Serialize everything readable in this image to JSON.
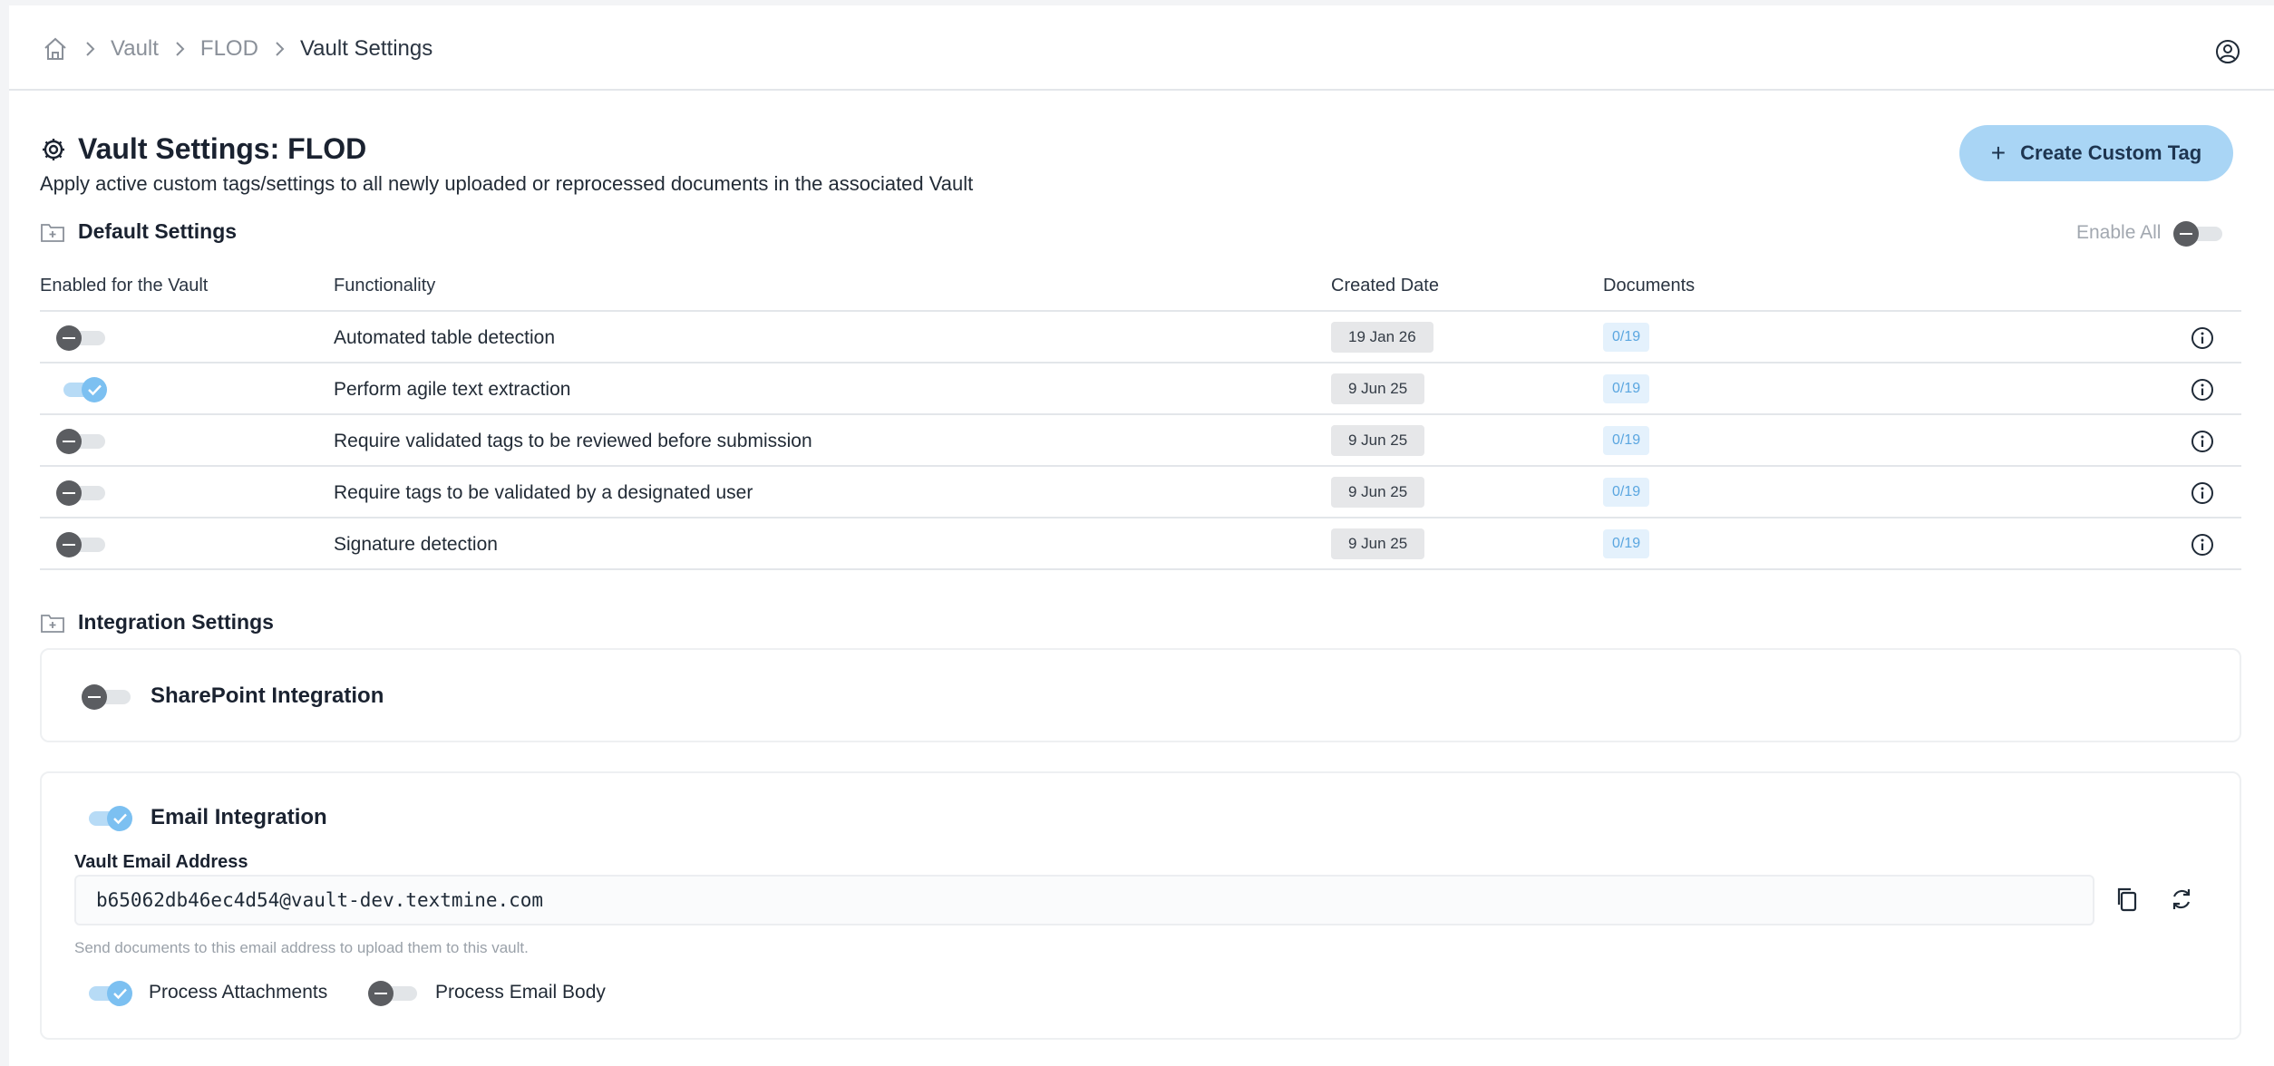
{
  "breadcrumb": {
    "icon": "home-icon",
    "items": [
      "Vault",
      "FLOD",
      "Vault Settings"
    ]
  },
  "user_icon": "user-circle-icon",
  "header": {
    "title": "Vault Settings: FLOD",
    "subtitle": "Apply active custom tags/settings to all newly uploaded or reprocessed documents in the associated Vault",
    "create_button": "Create Custom Tag"
  },
  "default_settings": {
    "title": "Default Settings",
    "enable_all_label": "Enable All",
    "enable_all_on": false,
    "columns": [
      "Enabled for the Vault",
      "Functionality",
      "Created Date",
      "Documents"
    ],
    "rows": [
      {
        "enabled": false,
        "functionality": "Automated table detection",
        "created": "19 Jan 26",
        "documents": "0/19"
      },
      {
        "enabled": true,
        "functionality": "Perform agile text extraction",
        "created": "9 Jun 25",
        "documents": "0/19"
      },
      {
        "enabled": false,
        "functionality": "Require validated tags to be reviewed before submission",
        "created": "9 Jun 25",
        "documents": "0/19"
      },
      {
        "enabled": false,
        "functionality": "Require tags to be validated by a designated user",
        "created": "9 Jun 25",
        "documents": "0/19"
      },
      {
        "enabled": false,
        "functionality": "Signature detection",
        "created": "9 Jun 25",
        "documents": "0/19"
      }
    ]
  },
  "integration_settings": {
    "title": "Integration Settings",
    "sharepoint": {
      "title": "SharePoint Integration",
      "enabled": false
    },
    "email": {
      "title": "Email Integration",
      "enabled": true,
      "address_label": "Vault Email Address",
      "address": "b65062db46ec4d54@vault-dev.textmine.com",
      "helper": "Send documents to this email address to upload them to this vault.",
      "process_attachments": {
        "label": "Process Attachments",
        "enabled": true
      },
      "process_body": {
        "label": "Process Email Body",
        "enabled": false
      }
    }
  },
  "colors": {
    "accent": "#a9d5f5",
    "toggle_on": "#7cc0f1",
    "toggle_off_knob": "#5b5d61",
    "documents_badge_text": "#5aa6e0"
  }
}
